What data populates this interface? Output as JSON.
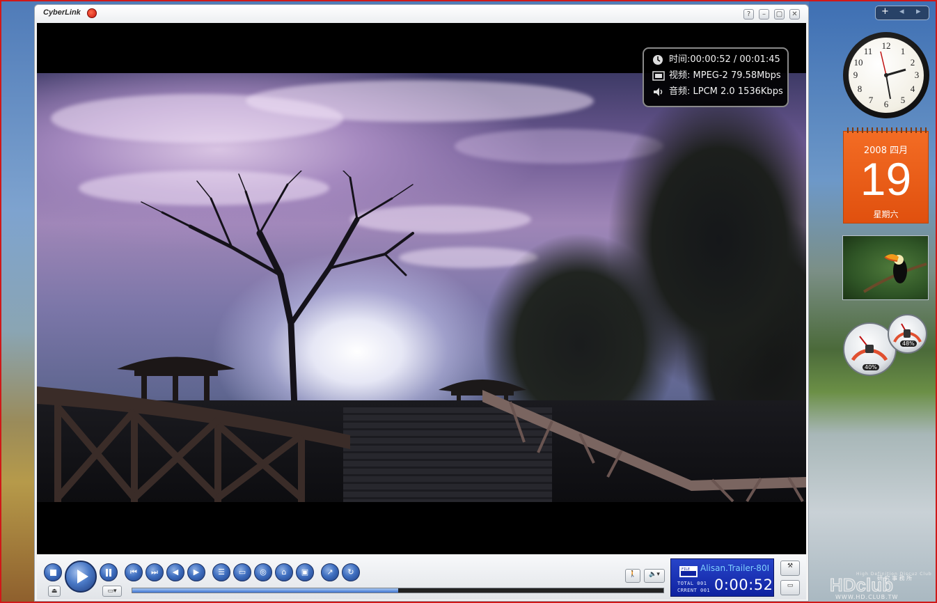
{
  "player": {
    "brand": "CyberLink",
    "window_buttons": [
      "?",
      "–",
      "▢",
      "✕"
    ]
  },
  "osd": {
    "time": "时间:00:00:52 / 00:01:45",
    "video": "视频: MPEG-2  79.58Mbps",
    "audio": "音频: LPCM 2.0   1536Kbps"
  },
  "controls": {
    "progress": 0.5,
    "volume_icon": "speaker-icon"
  },
  "lcd": {
    "file_label": "FILE",
    "file_name": "Alisan.Trailer-80I",
    "total_label": "TOTAL 001",
    "current_label": "CRRENT 001",
    "time": "0:00:52"
  },
  "gadgets": {
    "sidebar_add": "+",
    "calendar": {
      "year_month": "2008 四月",
      "day": "19",
      "weekday": "星期六"
    },
    "gauge_cpu": "40%",
    "gauge_mem": "48%"
  },
  "watermark": {
    "title": "HDclub",
    "subtitle": "High Definition Discuz Club",
    "url": "WWW.HD.CLUB.TW",
    "chinese": "研 究 事 務 所"
  }
}
